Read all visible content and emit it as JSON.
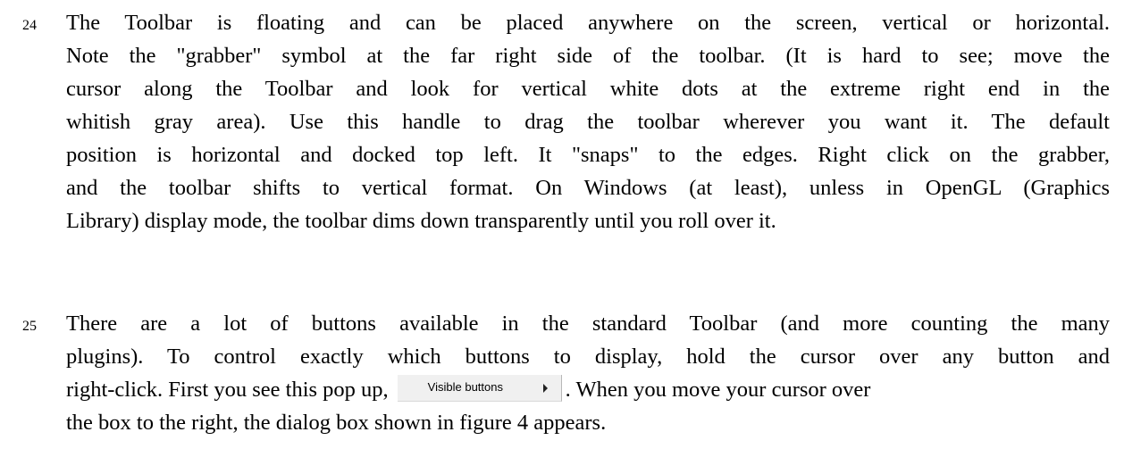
{
  "paragraph_24": {
    "number": "24",
    "lines": [
      "The Toolbar is floating and can be placed anywhere on the screen, vertical or horizontal.",
      "Note the \"grabber\" symbol at the far right side of the toolbar. (It is hard to see; move the",
      "cursor along the Toolbar and look for vertical white dots at the extreme right end in the",
      "whitish gray area).  Use this handle to drag the toolbar wherever you want it. The default",
      "position is horizontal and docked top left. It \"snaps\" to the edges. Right click on the grabber,",
      "and the toolbar shifts to vertical format. On Windows (at least), unless in OpenGL (Graphics",
      "Library) display mode, the toolbar dims down transparently until you roll over it."
    ]
  },
  "paragraph_25": {
    "number": "25",
    "lines": [
      "There are a lot of buttons available in the standard Toolbar (and more counting the many",
      "plugins). To control exactly which buttons to display, hold the cursor over any button and"
    ],
    "line3_before": "right-click. First you see this pop up,",
    "line3_after": ". When you move your cursor over",
    "line4": "the box to the right, the dialog box shown in figure 4 appears.",
    "popup": {
      "label": "Visible buttons",
      "arrow_icon": "submenu-arrow-icon"
    }
  }
}
